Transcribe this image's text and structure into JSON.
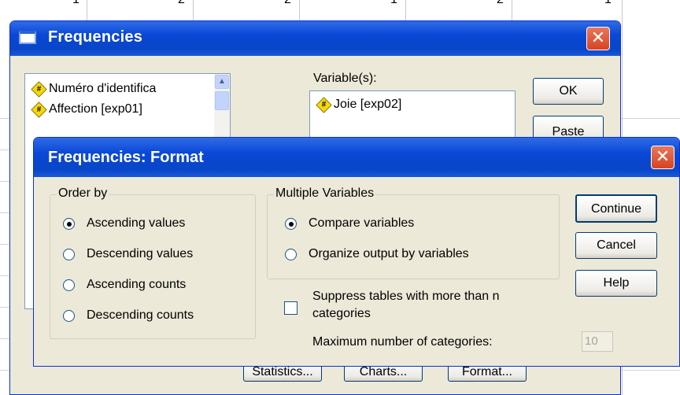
{
  "background_grid": {
    "top_numbers": [
      "1",
      "2",
      "2",
      "1",
      "2",
      "1"
    ]
  },
  "main_window": {
    "title": "Frequencies",
    "close_glyph": "✕",
    "source_list": [
      {
        "label": "Numéro d'identifica",
        "icon": "#"
      },
      {
        "label": "Affection [exp01]",
        "icon": "#"
      }
    ],
    "variables_label": "Variable(s):",
    "selected_variables": [
      {
        "label": "Joie [exp02]",
        "icon": "#"
      }
    ],
    "buttons": {
      "ok": "OK",
      "paste": "Paste",
      "statistics": "Statistics...",
      "charts": "Charts...",
      "format": "Format..."
    }
  },
  "format_dialog": {
    "title": "Frequencies: Format",
    "close_glyph": "✕",
    "order_by": {
      "legend": "Order by",
      "options": [
        {
          "label": "Ascending values",
          "selected": true
        },
        {
          "label": "Descending values",
          "selected": false
        },
        {
          "label": "Ascending counts",
          "selected": false
        },
        {
          "label": "Descending counts",
          "selected": false
        }
      ]
    },
    "multiple_variables": {
      "legend": "Multiple Variables",
      "options": [
        {
          "label": "Compare variables",
          "selected": true
        },
        {
          "label": "Organize output by variables",
          "selected": false
        }
      ]
    },
    "suppress_tables": {
      "label_line1": "Suppress tables with more than n",
      "label_line2": "categories",
      "checked": false
    },
    "max_categories": {
      "label": "Maximum number of categories:",
      "value": "10",
      "disabled": true
    },
    "buttons": {
      "continue": "Continue",
      "cancel": "Cancel",
      "help": "Help"
    }
  },
  "colors": {
    "titlebar": "#0a47d6",
    "dialog_face": "#ece9d8",
    "close_button": "#d64322",
    "variable_icon": "#f7d80a"
  }
}
